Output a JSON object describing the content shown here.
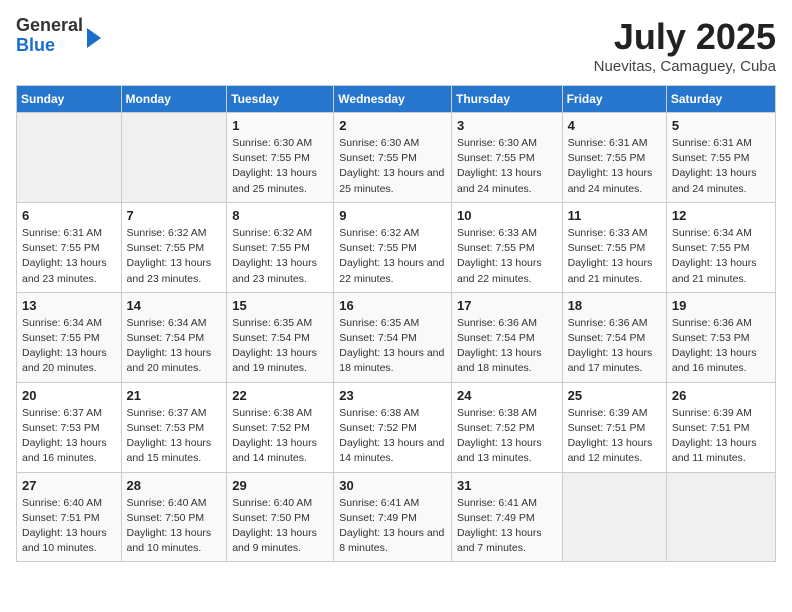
{
  "header": {
    "logo_line1": "General",
    "logo_line2": "Blue",
    "month_year": "July 2025",
    "location": "Nuevitas, Camaguey, Cuba"
  },
  "weekdays": [
    "Sunday",
    "Monday",
    "Tuesday",
    "Wednesday",
    "Thursday",
    "Friday",
    "Saturday"
  ],
  "weeks": [
    [
      {
        "day": null,
        "info": null
      },
      {
        "day": null,
        "info": null
      },
      {
        "day": "1",
        "sunrise": "6:30 AM",
        "sunset": "7:55 PM",
        "daylight": "13 hours and 25 minutes."
      },
      {
        "day": "2",
        "sunrise": "6:30 AM",
        "sunset": "7:55 PM",
        "daylight": "13 hours and 25 minutes."
      },
      {
        "day": "3",
        "sunrise": "6:30 AM",
        "sunset": "7:55 PM",
        "daylight": "13 hours and 24 minutes."
      },
      {
        "day": "4",
        "sunrise": "6:31 AM",
        "sunset": "7:55 PM",
        "daylight": "13 hours and 24 minutes."
      },
      {
        "day": "5",
        "sunrise": "6:31 AM",
        "sunset": "7:55 PM",
        "daylight": "13 hours and 24 minutes."
      }
    ],
    [
      {
        "day": "6",
        "sunrise": "6:31 AM",
        "sunset": "7:55 PM",
        "daylight": "13 hours and 23 minutes."
      },
      {
        "day": "7",
        "sunrise": "6:32 AM",
        "sunset": "7:55 PM",
        "daylight": "13 hours and 23 minutes."
      },
      {
        "day": "8",
        "sunrise": "6:32 AM",
        "sunset": "7:55 PM",
        "daylight": "13 hours and 23 minutes."
      },
      {
        "day": "9",
        "sunrise": "6:32 AM",
        "sunset": "7:55 PM",
        "daylight": "13 hours and 22 minutes."
      },
      {
        "day": "10",
        "sunrise": "6:33 AM",
        "sunset": "7:55 PM",
        "daylight": "13 hours and 22 minutes."
      },
      {
        "day": "11",
        "sunrise": "6:33 AM",
        "sunset": "7:55 PM",
        "daylight": "13 hours and 21 minutes."
      },
      {
        "day": "12",
        "sunrise": "6:34 AM",
        "sunset": "7:55 PM",
        "daylight": "13 hours and 21 minutes."
      }
    ],
    [
      {
        "day": "13",
        "sunrise": "6:34 AM",
        "sunset": "7:55 PM",
        "daylight": "13 hours and 20 minutes."
      },
      {
        "day": "14",
        "sunrise": "6:34 AM",
        "sunset": "7:54 PM",
        "daylight": "13 hours and 20 minutes."
      },
      {
        "day": "15",
        "sunrise": "6:35 AM",
        "sunset": "7:54 PM",
        "daylight": "13 hours and 19 minutes."
      },
      {
        "day": "16",
        "sunrise": "6:35 AM",
        "sunset": "7:54 PM",
        "daylight": "13 hours and 18 minutes."
      },
      {
        "day": "17",
        "sunrise": "6:36 AM",
        "sunset": "7:54 PM",
        "daylight": "13 hours and 18 minutes."
      },
      {
        "day": "18",
        "sunrise": "6:36 AM",
        "sunset": "7:54 PM",
        "daylight": "13 hours and 17 minutes."
      },
      {
        "day": "19",
        "sunrise": "6:36 AM",
        "sunset": "7:53 PM",
        "daylight": "13 hours and 16 minutes."
      }
    ],
    [
      {
        "day": "20",
        "sunrise": "6:37 AM",
        "sunset": "7:53 PM",
        "daylight": "13 hours and 16 minutes."
      },
      {
        "day": "21",
        "sunrise": "6:37 AM",
        "sunset": "7:53 PM",
        "daylight": "13 hours and 15 minutes."
      },
      {
        "day": "22",
        "sunrise": "6:38 AM",
        "sunset": "7:52 PM",
        "daylight": "13 hours and 14 minutes."
      },
      {
        "day": "23",
        "sunrise": "6:38 AM",
        "sunset": "7:52 PM",
        "daylight": "13 hours and 14 minutes."
      },
      {
        "day": "24",
        "sunrise": "6:38 AM",
        "sunset": "7:52 PM",
        "daylight": "13 hours and 13 minutes."
      },
      {
        "day": "25",
        "sunrise": "6:39 AM",
        "sunset": "7:51 PM",
        "daylight": "13 hours and 12 minutes."
      },
      {
        "day": "26",
        "sunrise": "6:39 AM",
        "sunset": "7:51 PM",
        "daylight": "13 hours and 11 minutes."
      }
    ],
    [
      {
        "day": "27",
        "sunrise": "6:40 AM",
        "sunset": "7:51 PM",
        "daylight": "13 hours and 10 minutes."
      },
      {
        "day": "28",
        "sunrise": "6:40 AM",
        "sunset": "7:50 PM",
        "daylight": "13 hours and 10 minutes."
      },
      {
        "day": "29",
        "sunrise": "6:40 AM",
        "sunset": "7:50 PM",
        "daylight": "13 hours and 9 minutes."
      },
      {
        "day": "30",
        "sunrise": "6:41 AM",
        "sunset": "7:49 PM",
        "daylight": "13 hours and 8 minutes."
      },
      {
        "day": "31",
        "sunrise": "6:41 AM",
        "sunset": "7:49 PM",
        "daylight": "13 hours and 7 minutes."
      },
      {
        "day": null,
        "info": null
      },
      {
        "day": null,
        "info": null
      }
    ]
  ]
}
